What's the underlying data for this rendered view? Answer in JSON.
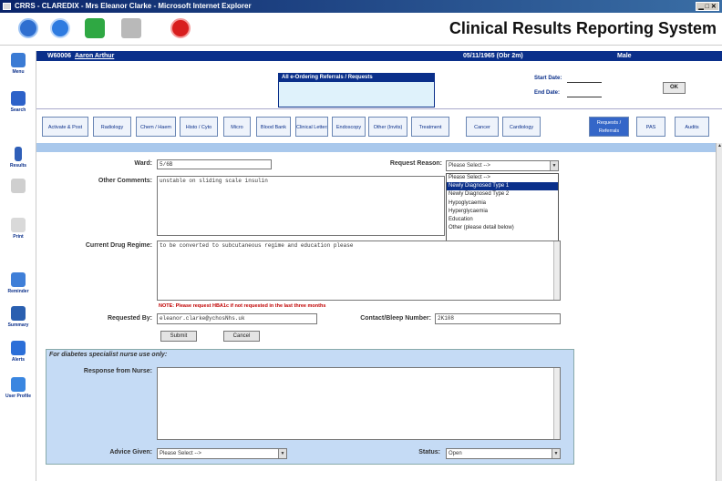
{
  "window": {
    "title": "CRRS - CLAREDIX - Mrs Eleanor Clarke - Microsoft Internet Explorer",
    "controls": "▁ □ ✕"
  },
  "app": {
    "title": "Clinical Results Reporting System"
  },
  "patient": {
    "id": "W60006",
    "name": "Aaron Arthur",
    "dob": "05/11/1965 (Obr 2m)",
    "sex": "Male"
  },
  "ordering": {
    "header": "All e-Ordering Referrals / Requests"
  },
  "dates": {
    "start_label": "Start Date:",
    "end_label": "End Date:",
    "ok_label": "OK"
  },
  "tabs": [
    {
      "label": "Activate & Post"
    },
    {
      "label": "Radiology"
    },
    {
      "label": "Chem / Haem"
    },
    {
      "label": "Histo / Cyto"
    },
    {
      "label": "Micro"
    },
    {
      "label": "Blood Bank"
    },
    {
      "label": "Clinical Letters"
    },
    {
      "label": "Endoscopy"
    },
    {
      "label": "Other (Invits)"
    },
    {
      "label": "Treatment"
    },
    {
      "label": "Cancer"
    },
    {
      "label": "Cardiology"
    },
    {
      "label": "Requests / Referrals"
    },
    {
      "label": "PAS"
    },
    {
      "label": "Audits"
    }
  ],
  "sidebar": [
    {
      "label": "Menu"
    },
    {
      "label": "Search"
    },
    {
      "label": "Results"
    },
    {
      "label": ""
    },
    {
      "label": "Print"
    },
    {
      "label": "Reminder"
    },
    {
      "label": "Summary"
    },
    {
      "label": "Alerts"
    },
    {
      "label": "User Profile"
    }
  ],
  "form": {
    "ward_label": "Ward:",
    "ward_value": "5/6B",
    "reason_label": "Request Reason:",
    "reason_value": "Please Select -->",
    "reason_options": [
      "Please Select -->",
      "Newly Diagnosed Type 1",
      "Newly Diagnosed Type 2",
      "Hypoglycaemia",
      "Hyperglycaemia",
      "Education",
      "Other (please detail below)"
    ],
    "comments_label": "Other Comments:",
    "comments_value": "unstable on sliding scale insulin",
    "drug_label": "Current Drug Regime:",
    "drug_value": "to be converted to subcutaneous regime and education please",
    "warning": "NOTE: Please request HBA1c if not requested in the last three months",
    "requested_by_label": "Requested By:",
    "requested_by_value": "eleanor.clarke@ychosNhs.uk",
    "contact_label": "Contact/Bleep Number:",
    "contact_value": "2K108",
    "submit_label": "Submit",
    "cancel_label": "Cancel"
  },
  "nurse": {
    "header": "For diabetes specialist nurse use only:",
    "response_label": "Response from Nurse:",
    "response_value": "",
    "advice_label": "Advice Given:",
    "advice_value": "Please Select -->",
    "status_label": "Status:",
    "status_value": "Open"
  }
}
